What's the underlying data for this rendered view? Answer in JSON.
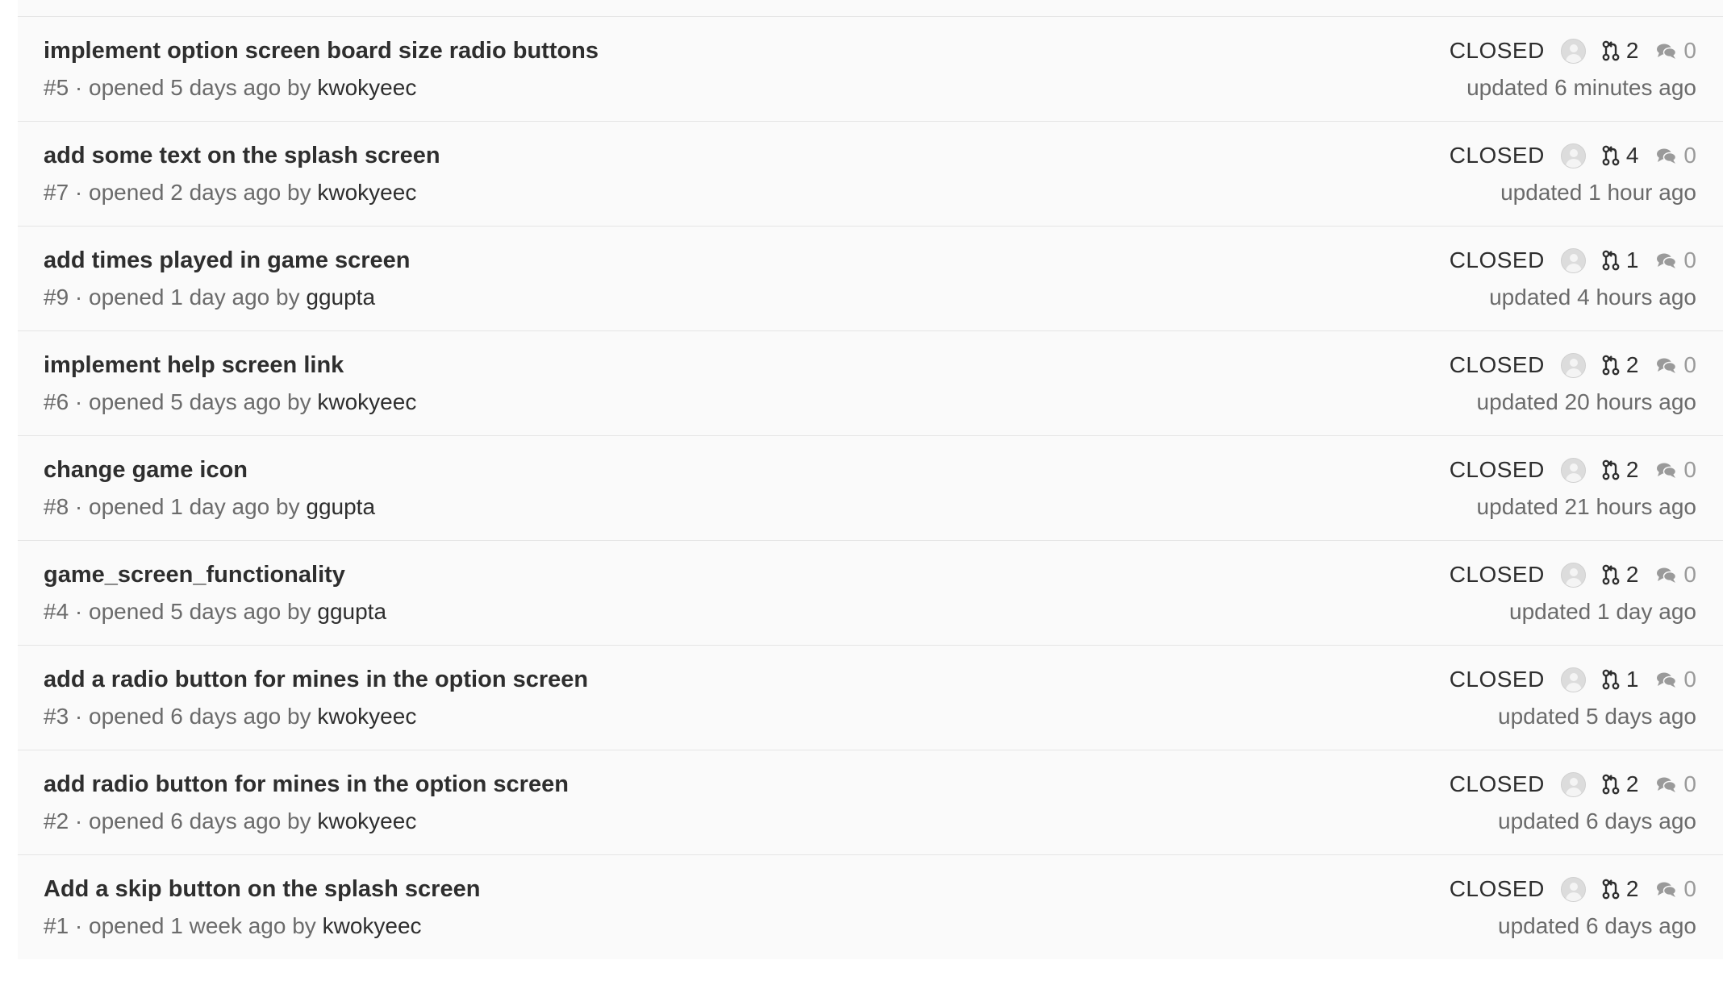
{
  "issues": [
    {
      "title": "implement option screen board size radio buttons",
      "meta_prefix": "#5 · opened 5 days ago by ",
      "author": "kwokyeec",
      "status": "CLOSED",
      "merge_requests": "2",
      "comments": "0",
      "updated": "updated 6 minutes ago"
    },
    {
      "title": "add some text on the splash screen",
      "meta_prefix": "#7 · opened 2 days ago by ",
      "author": "kwokyeec",
      "status": "CLOSED",
      "merge_requests": "4",
      "comments": "0",
      "updated": "updated 1 hour ago"
    },
    {
      "title": "add times played in game screen",
      "meta_prefix": "#9 · opened 1 day ago by ",
      "author": "ggupta",
      "status": "CLOSED",
      "merge_requests": "1",
      "comments": "0",
      "updated": "updated 4 hours ago"
    },
    {
      "title": "implement help screen link",
      "meta_prefix": "#6 · opened 5 days ago by ",
      "author": "kwokyeec",
      "status": "CLOSED",
      "merge_requests": "2",
      "comments": "0",
      "updated": "updated 20 hours ago"
    },
    {
      "title": "change game icon",
      "meta_prefix": "#8 · opened 1 day ago by ",
      "author": "ggupta",
      "status": "CLOSED",
      "merge_requests": "2",
      "comments": "0",
      "updated": "updated 21 hours ago"
    },
    {
      "title": "game_screen_functionality",
      "meta_prefix": "#4 · opened 5 days ago by ",
      "author": "ggupta",
      "status": "CLOSED",
      "merge_requests": "2",
      "comments": "0",
      "updated": "updated 1 day ago"
    },
    {
      "title": "add a radio button for mines in the option screen",
      "meta_prefix": "#3 · opened 6 days ago by ",
      "author": "kwokyeec",
      "status": "CLOSED",
      "merge_requests": "1",
      "comments": "0",
      "updated": "updated 5 days ago"
    },
    {
      "title": "add radio button for mines in the option screen",
      "meta_prefix": "#2 · opened 6 days ago by ",
      "author": "kwokyeec",
      "status": "CLOSED",
      "merge_requests": "2",
      "comments": "0",
      "updated": "updated 6 days ago"
    },
    {
      "title": "Add a skip button on the splash screen",
      "meta_prefix": "#1 · opened 1 week ago by ",
      "author": "kwokyeec",
      "status": "CLOSED",
      "merge_requests": "2",
      "comments": "0",
      "updated": "updated 6 days ago"
    }
  ]
}
